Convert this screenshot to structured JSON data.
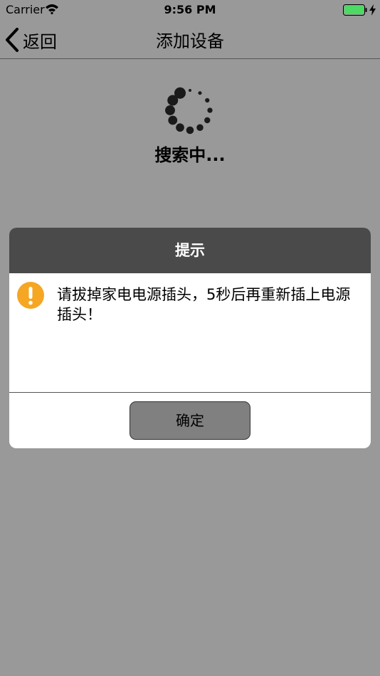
{
  "status_bar": {
    "carrier": "Carrier",
    "time": "9:56 PM",
    "wifi_icon": "wifi-icon",
    "battery_icon": "battery-full-icon",
    "charging_icon": "bolt-icon",
    "battery_color": "#4cd964",
    "battery_level": 1.0
  },
  "nav": {
    "back_label": "返回",
    "back_icon": "chevron-left-icon",
    "title": "添加设备"
  },
  "main": {
    "spinner_icon": "loading-spinner-icon",
    "status_text": "搜索中..."
  },
  "dialog": {
    "title": "提示",
    "warning_icon": "warning-icon",
    "warning_color": "#f5a623",
    "message": "请拔掉家电电源插头，5秒后再重新插上电源插头！",
    "confirm_label": "确定"
  },
  "colors": {
    "overlay_background": "#999999",
    "dialog_header": "#4a4a4a",
    "button_background": "#808080"
  }
}
